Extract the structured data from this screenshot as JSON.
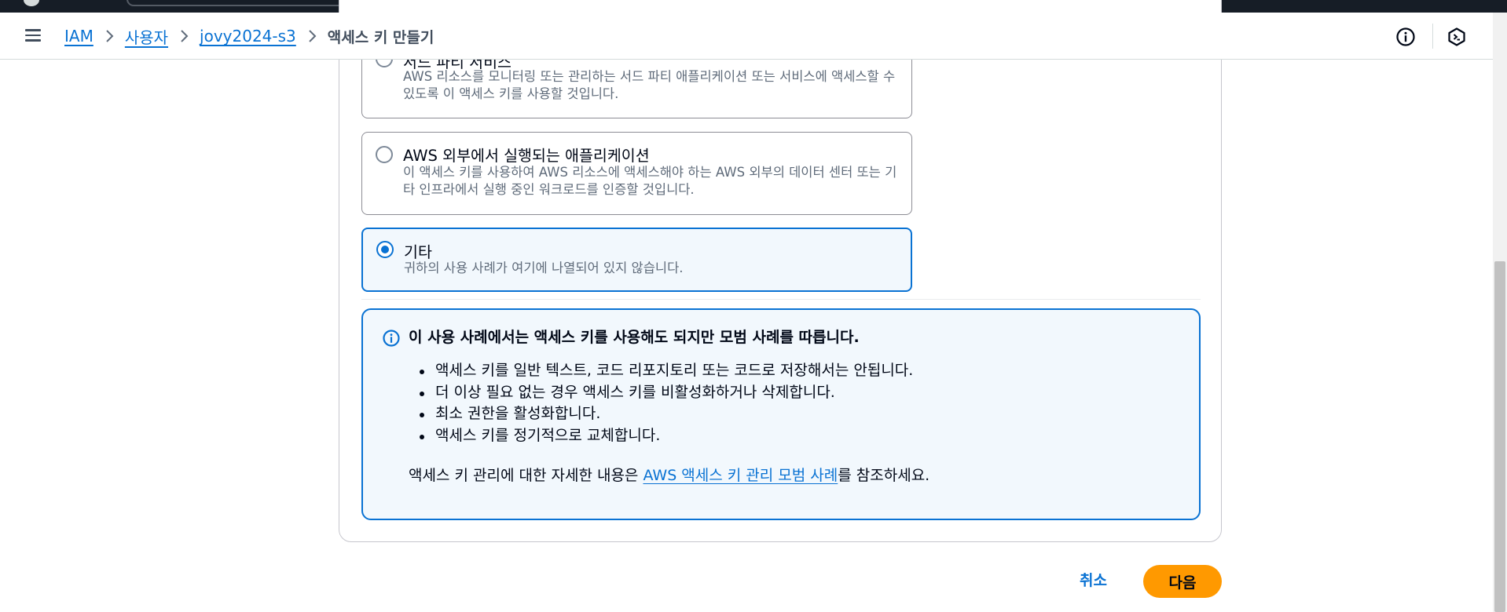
{
  "breadcrumbs": {
    "iam": "IAM",
    "users": "사용자",
    "user": "jovy2024-s3",
    "current": "액세스 키 만들기"
  },
  "options": [
    {
      "title": "서드 파티 서비스",
      "description": "AWS 리소스를 모니터링 또는 관리하는 서드 파티 애플리케이션 또는 서비스에 액세스할 수 있도록 이 액세스 키를 사용할 것입니다.",
      "selected": false
    },
    {
      "title": "AWS 외부에서 실행되는 애플리케이션",
      "description": "이 액세스 키를 사용하여 AWS 리소스에 액세스해야 하는 AWS 외부의 데이터 센터 또는 기타 인프라에서 실행 중인 워크로드를 인증할 것입니다.",
      "selected": false
    },
    {
      "title": "기타",
      "description": "귀하의 사용 사례가 여기에 나열되어 있지 않습니다.",
      "selected": true
    }
  ],
  "alert": {
    "title": "이 사용 사례에서는 액세스 키를 사용해도 되지만 모범 사례를 따릅니다.",
    "items": [
      "액세스 키를 일반 텍스트, 코드 리포지토리 또는 코드로 저장해서는 안됩니다.",
      "더 이상 필요 없는 경우 액세스 키를 비활성화하거나 삭제합니다.",
      "최소 권한을 활성화합니다.",
      "액세스 키를 정기적으로 교체합니다."
    ],
    "footer_prefix": "액세스 키 관리에 대한 자세한 내용은 ",
    "footer_link": "AWS 액세스 키 관리 모범 사례",
    "footer_suffix": "를 참조하세요."
  },
  "actions": {
    "cancel": "취소",
    "next": "다음"
  },
  "colors": {
    "accent": "#0972d3",
    "primary_button": "#ff9900",
    "alert_bg": "#f2f8fd"
  },
  "icons": [
    "hamburger-menu-icon",
    "chevron-right-icon",
    "info-circle-icon",
    "cloudshell-icon"
  ]
}
